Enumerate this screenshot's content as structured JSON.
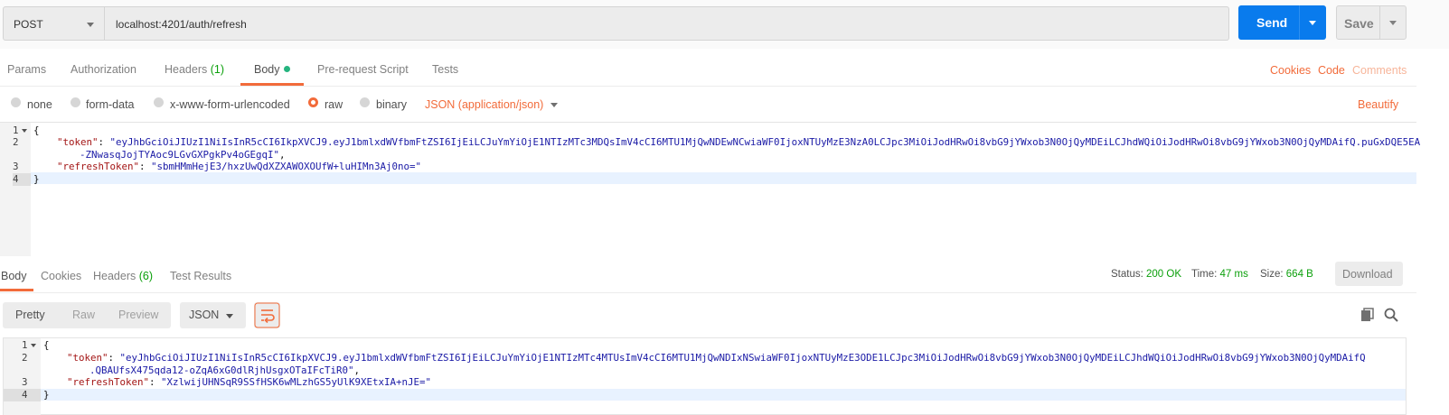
{
  "request": {
    "method": "POST",
    "url": "localhost:4201/auth/refresh",
    "send_label": "Send",
    "save_label": "Save"
  },
  "request_tabs": [
    {
      "label": "Params"
    },
    {
      "label": "Authorization"
    },
    {
      "label": "Headers",
      "count": "(1)"
    },
    {
      "label": "Body"
    },
    {
      "label": "Pre-request Script"
    },
    {
      "label": "Tests"
    }
  ],
  "request_links": {
    "cookies": "Cookies",
    "code": "Code",
    "comments": "Comments"
  },
  "body_options": {
    "none": "none",
    "form_data": "form-data",
    "urlencoded": "x-www-form-urlencoded",
    "raw": "raw",
    "binary": "binary",
    "selected": "raw",
    "content_type": "JSON (application/json)",
    "beautify": "Beautify"
  },
  "request_body": {
    "line_numbers": [
      "1",
      "2",
      "3",
      "4"
    ],
    "open_brace": "{",
    "close_brace": "}",
    "token_key": "\"token\"",
    "token_value_1": "\"eyJhbGciOiJIUzI1NiIsInR5cCI6IkpXVCJ9.eyJ1bmlxdWVfbmFtZSI6IjEiLCJuYmYiOjE1NTIzMTc3MDQsImV4cCI6MTU1MjQwNDEwNCwiaWF0IjoxNTUyMzE3NzA0LCJpc3MiOiJodHRwOi8vbG9jYWxob3N0OjQyMDEiLCJhdWQiOiJodHRwOi8vbG9jYWxob3N0OjQyMDAifQ.puGxDQE5EA",
    "token_value_2": "-ZNwasqJojTYAoc9LGvGXPgkPv4oGEgqI\"",
    "refresh_key": "\"refreshToken\"",
    "refresh_value": "\"sbmHMmHejE3/hxzUwQdXZXAWOXOUfW+luHIMn3Aj0no=\""
  },
  "response_tabs": [
    {
      "label": "Body"
    },
    {
      "label": "Cookies"
    },
    {
      "label": "Headers",
      "count": "(6)"
    },
    {
      "label": "Test Results"
    }
  ],
  "response_meta": {
    "status_label": "Status:",
    "status_value": "200 OK",
    "time_label": "Time:",
    "time_value": "47 ms",
    "size_label": "Size:",
    "size_value": "664 B",
    "download": "Download"
  },
  "response_view": {
    "pretty": "Pretty",
    "raw": "Raw",
    "preview": "Preview",
    "format": "JSON"
  },
  "response_body": {
    "line_numbers": [
      "1",
      "2",
      "3",
      "4"
    ],
    "open_brace": "{",
    "close_brace": "}",
    "token_key": "\"token\"",
    "token_value_1": "\"eyJhbGciOiJIUzI1NiIsInR5cCI6IkpXVCJ9.eyJ1bmlxdWVfbmFtZSI6IjEiLCJuYmYiOjE1NTIzMTc4MTUsImV4cCI6MTU1MjQwNDIxNSwiaWF0IjoxNTUyMzE3ODE1LCJpc3MiOiJodHRwOi8vbG9jYWxob3N0OjQyMDEiLCJhdWQiOiJodHRwOi8vbG9jYWxob3N0OjQyMDAifQ",
    "token_value_2": ".QBAUfsX475qda12-oZqA6xG0dlRjhUsgxOTaIFcTiR0\"",
    "refresh_key": "\"refreshToken\"",
    "refresh_value": "\"XzlwijUHNSqR9SSfHSK6wMLzhGS5yUlK9XEtxIA+nJE=\""
  },
  "colors": {
    "accent": "#f26b3a",
    "send": "#097bed",
    "success": "#0ca00c",
    "dot": "#26b47f"
  },
  "icons": [
    "caret-down-icon",
    "wrap-lines-icon",
    "copy-icon",
    "search-icon"
  ]
}
